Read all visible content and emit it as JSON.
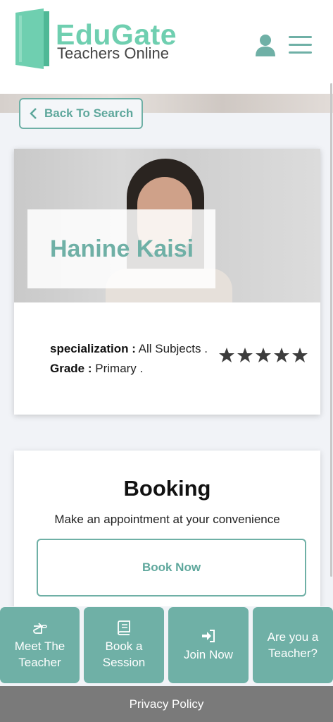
{
  "header": {
    "logo_title": "EduGate",
    "logo_subtitle": "Teachers Online",
    "brand_color": "#6fcfb0",
    "user_icon": "user-icon",
    "menu_icon": "hamburger-menu-icon"
  },
  "back_button": {
    "label": "Back To Search",
    "icon": "chevron-left-icon"
  },
  "teacher": {
    "name": "Hanine Kaisi",
    "specialization_label": "specialization :",
    "specialization_value": " All Subjects .",
    "grade_label": "Grade :",
    "grade_value": " Primary .",
    "rating": 5,
    "rating_max": 5
  },
  "booking": {
    "title": "Booking",
    "subtitle": "Make an appointment at your convenience",
    "button_label": "Book Now"
  },
  "bottom_nav": [
    {
      "line1": "Meet The",
      "line2": "Teacher",
      "icon": "hand-pointing-icon"
    },
    {
      "line1": "Book a",
      "line2": "Session",
      "icon": "book-icon"
    },
    {
      "line1": "Join Now",
      "line2": "",
      "icon": "sign-in-icon"
    },
    {
      "line1": "Are you a",
      "line2": "Teacher?",
      "icon": ""
    }
  ],
  "footer": {
    "label": "Privacy Policy"
  },
  "colors": {
    "accent": "#6fb0a6",
    "footer_bg": "#7a7a7a",
    "page_bg": "#f1f3f7"
  }
}
